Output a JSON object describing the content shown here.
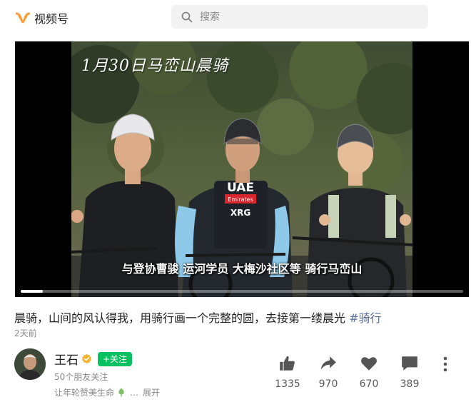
{
  "header": {
    "app_name": "视频号",
    "search_placeholder": "搜索"
  },
  "video": {
    "overlay_title": "1月30日马峦山晨骑",
    "subtitle": "与登协曹骏 运河学员 大梅沙社区等 骑行马峦山",
    "jersey_text": "UAE",
    "jersey_sponsor": "Emirates",
    "jersey_brand": "XRG",
    "progress": 0.05
  },
  "post": {
    "caption": "晨骑，山间的风认得我，用骑行画一个完整的圆，去接第一缕晨光 ",
    "hashtag": "#骑行",
    "time": "2天前"
  },
  "author": {
    "name": "王石",
    "follow_label": "+关注",
    "friends": "50个朋友关注",
    "like_line": "让年轮赞美生命",
    "expand_label": "展开"
  },
  "actions": {
    "like_count": "1335",
    "share_count": "970",
    "favorite_count": "670",
    "comment_count": "389"
  },
  "colors": {
    "accent": "#07c160",
    "logo": "#fa9d3b",
    "hashtag": "#576b95",
    "verified": "#f6b42f"
  }
}
